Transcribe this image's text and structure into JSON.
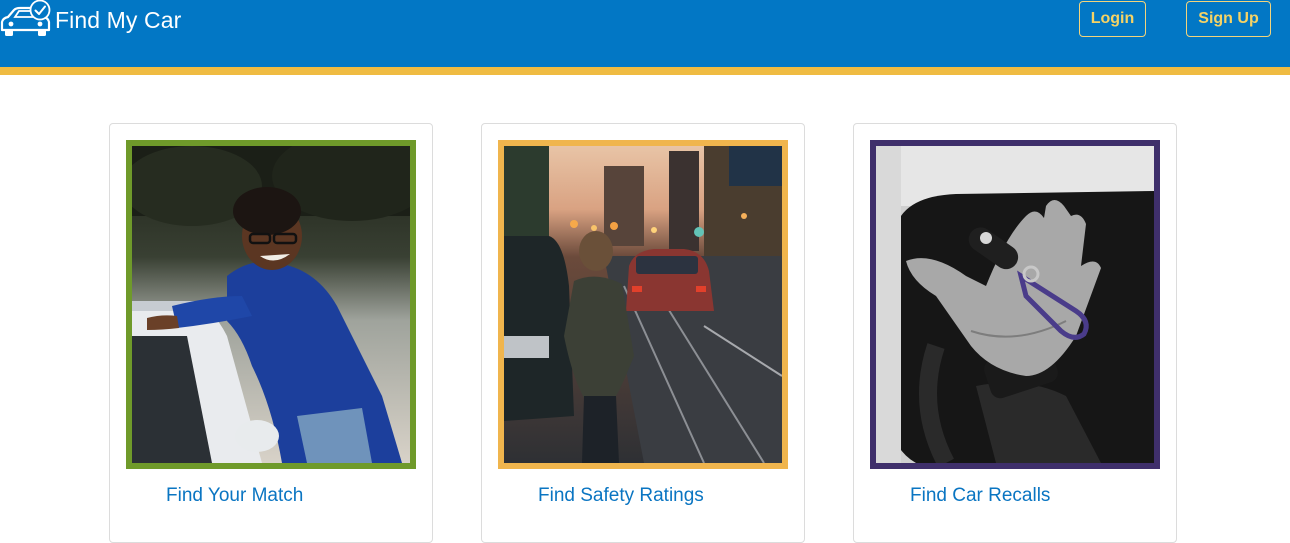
{
  "app": {
    "brand_name": "Find My Car",
    "brand_icon": "car-check-icon"
  },
  "nav": {
    "login_label": "Login",
    "signup_label": "Sign Up"
  },
  "colors": {
    "navbar": "#0277c5",
    "stripe": "#efbb42",
    "button_text": "#f6d365",
    "card_title": "#0a75c2",
    "frame_green": "#6f9a2a",
    "frame_gold": "#f0b54d",
    "frame_purple": "#3f2f6b"
  },
  "cards": [
    {
      "title": "Find Your Match",
      "image": "woman-leaning-on-car-photo",
      "frame_color": "#6f9a2a"
    },
    {
      "title": "Find Safety Ratings",
      "image": "man-on-city-street-photo",
      "frame_color": "#f0b54d"
    },
    {
      "title": "Find Car Recalls",
      "image": "hand-holding-car-key-photo",
      "frame_color": "#3f2f6b"
    }
  ]
}
